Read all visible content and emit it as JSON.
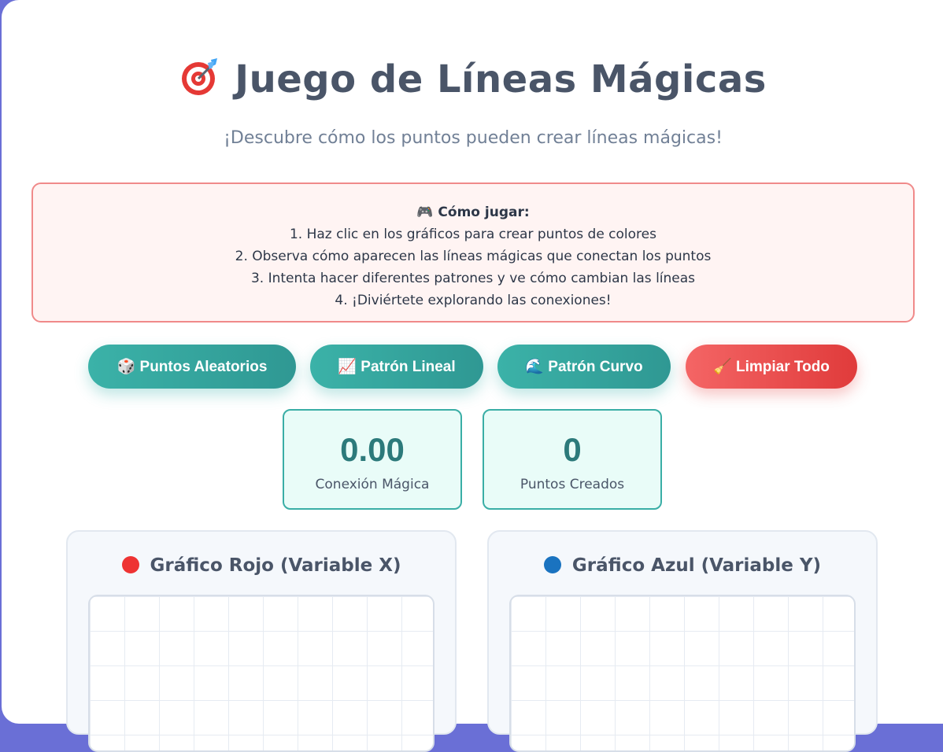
{
  "header": {
    "title": "Juego de Líneas Mágicas",
    "subtitle": "¡Descubre cómo los puntos pueden crear líneas mágicas!"
  },
  "instructions": {
    "heading": "🎮 Cómo jugar:",
    "steps": [
      "1. Haz clic en los gráficos para crear puntos de colores",
      "2. Observa cómo aparecen las líneas mágicas que conectan los puntos",
      "3. Intenta hacer diferentes patrones y ve cómo cambian las líneas",
      "4. ¡Diviértete explorando las conexiones!"
    ]
  },
  "buttons": {
    "random": "🎲 Puntos Aleatorios",
    "linear": "📈 Patrón Lineal",
    "curve": "🌊 Patrón Curvo",
    "clear": "🧹 Limpiar Todo"
  },
  "stats": {
    "connection_value": "0.00",
    "connection_label": "Conexión Mágica",
    "points_value": "0",
    "points_label": "Puntos Creados"
  },
  "charts": {
    "red_title": "Gráfico Rojo (Variable X)",
    "blue_title": "Gráfico Azul (Variable Y)"
  },
  "colors": {
    "red_dot": "#ee3333",
    "blue_dot": "#1a73c0",
    "teal": "#3bb2a8",
    "danger": "#e53e3e"
  }
}
